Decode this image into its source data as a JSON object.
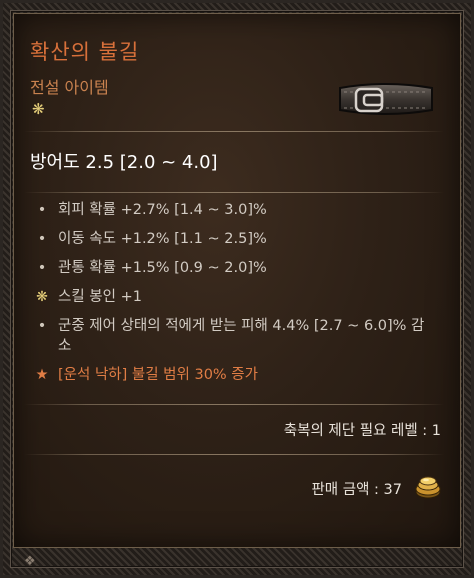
{
  "item": {
    "name": "확산의 불길",
    "rarity": "전설 아이템",
    "armor": "방어도 2.5 [2.0 ~ 4.0]"
  },
  "stats": [
    {
      "marker": "•",
      "text": "회피 확률 +2.7% [1.4 ~ 3.0]%"
    },
    {
      "marker": "•",
      "text": "이동 속도 +1.2% [1.1 ~ 2.5]%"
    },
    {
      "marker": "•",
      "text": "관통 확률 +1.5% [0.9 ~ 2.0]%"
    },
    {
      "marker": "❋",
      "text": "스킬 봉인 +1"
    },
    {
      "marker": "•",
      "text": "군중 제어 상태의 적에게 받는 피해 4.4% [2.7 ~ 6.0]%  감소"
    },
    {
      "marker": "★",
      "text": "[운석 낙하] 불길 범위 30% 증가"
    }
  ],
  "requirement": "축복의 제단 필요 레벨 : 1",
  "sell_price": "판매 금액 : 37",
  "icons": {
    "rarity": "flower-icon",
    "item": "belt-icon",
    "currency": "gold-coins-icon"
  },
  "colors": {
    "legendary_name": "#d8703a",
    "legendary_affix": "#e07d45",
    "seal": "#e6cf7a",
    "text": "#d2cbc3"
  }
}
